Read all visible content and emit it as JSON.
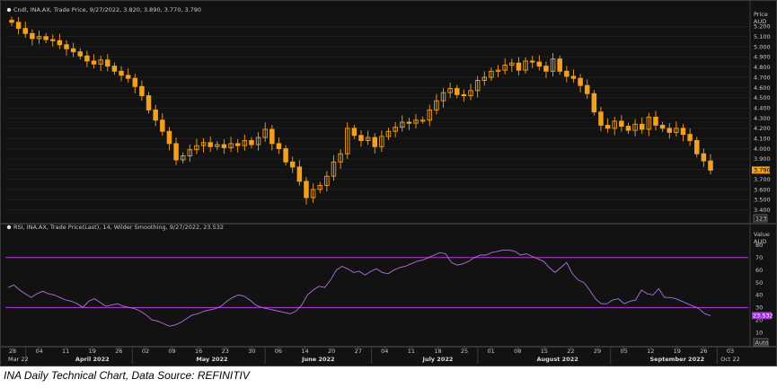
{
  "caption": "INA Daily Technical Chart, Data Source: REFINITIV",
  "chart_data": [
    {
      "type": "candlestick",
      "legend": "Cndl, INA.AX, Trade Price, 9/27/2022, 3.820, 3.890, 3.770, 3.790",
      "ylabel": "Price",
      "yunit": "AUD",
      "ylim": [
        3.3,
        5.3
      ],
      "yticks": [
        "5.200",
        "5.100",
        "5.000",
        "4.900",
        "4.800",
        "4.700",
        "4.600",
        "4.500",
        "4.400",
        "4.300",
        "4.200",
        "4.100",
        "4.000",
        "3.900",
        "3.800",
        "3.700",
        "3.600",
        "3.500",
        "3.400"
      ],
      "last_price": "3.790",
      "scale_button": "123",
      "color": "#f2a01e",
      "close": [
        5.24,
        5.18,
        5.13,
        5.08,
        5.1,
        5.07,
        5.06,
        5.02,
        4.98,
        4.95,
        4.91,
        4.86,
        4.83,
        4.87,
        4.81,
        4.76,
        4.72,
        4.69,
        4.61,
        4.52,
        4.38,
        4.28,
        4.17,
        4.05,
        3.89,
        3.93,
        3.99,
        4.03,
        4.06,
        4.02,
        4.04,
        4.01,
        4.05,
        4.03,
        4.08,
        4.04,
        4.11,
        4.19,
        4.05,
        4.0,
        3.87,
        3.82,
        3.68,
        3.52,
        3.6,
        3.64,
        3.73,
        3.87,
        3.95,
        4.2,
        4.13,
        4.08,
        4.11,
        4.02,
        4.12,
        4.17,
        4.21,
        4.26,
        4.25,
        4.28,
        4.28,
        4.38,
        4.47,
        4.55,
        4.59,
        4.53,
        4.52,
        4.57,
        4.67,
        4.7,
        4.76,
        4.77,
        4.82,
        4.84,
        4.77,
        4.86,
        4.85,
        4.81,
        4.76,
        4.88,
        4.76,
        4.71,
        4.69,
        4.62,
        4.54,
        4.36,
        4.23,
        4.2,
        4.27,
        4.22,
        4.18,
        4.24,
        4.19,
        4.31,
        4.23,
        4.2,
        4.16,
        4.2,
        4.14,
        4.08,
        3.95,
        3.88,
        3.79
      ],
      "x_day_labels": [
        "28",
        "04",
        "11",
        "19",
        "26",
        "02",
        "09",
        "16",
        "23",
        "30",
        "06",
        "14",
        "20",
        "27",
        "04",
        "11",
        "18",
        "25",
        "01",
        "08",
        "15",
        "22",
        "29",
        "05",
        "12",
        "19",
        "26",
        "03"
      ],
      "x_month_labels": [
        "Mar 22",
        "April 2022",
        "May 2022",
        "June 2022",
        "July 2022",
        "August 2022",
        "September 2022",
        "Oct 22"
      ],
      "x_last_label": "Oct 22"
    },
    {
      "type": "line",
      "legend": "RSI, INA.AX, Trade Price(Last), 14, Wilder Smoothing, 9/27/2022, 23.532",
      "ylabel": "Value",
      "yunit": "AUD",
      "ylim": [
        0,
        90
      ],
      "yticks": [
        "80",
        "70",
        "60",
        "50",
        "40",
        "30",
        "20",
        "10"
      ],
      "overbought": 70,
      "oversold": 30,
      "last_value": "23.532",
      "scale_button": "Auto",
      "color": "#b46fe0",
      "values": [
        46,
        48,
        44,
        41,
        38,
        41,
        43,
        41,
        40,
        38,
        36,
        35,
        33,
        30,
        35,
        37,
        34,
        31,
        32,
        33,
        31,
        30,
        29,
        27,
        24,
        20,
        19,
        17,
        15,
        16,
        18,
        21,
        24,
        25,
        27,
        28,
        29,
        31,
        35,
        38,
        40,
        39,
        36,
        32,
        30,
        29,
        28,
        27,
        26,
        25,
        27,
        32,
        40,
        44,
        47,
        46,
        52,
        60,
        63,
        61,
        58,
        59,
        56,
        59,
        61,
        58,
        57,
        60,
        62,
        63,
        65,
        67,
        68,
        70,
        72,
        74,
        73,
        66,
        64,
        65,
        67,
        70,
        72,
        72,
        74,
        75,
        76,
        76,
        75,
        72,
        73,
        71,
        69,
        67,
        62,
        58,
        62,
        66,
        57,
        52,
        50,
        44,
        37,
        33,
        33,
        36,
        37,
        33,
        35,
        36,
        44,
        41,
        40,
        45,
        38,
        38,
        37,
        35,
        33,
        31,
        29,
        25,
        23.5
      ]
    }
  ]
}
